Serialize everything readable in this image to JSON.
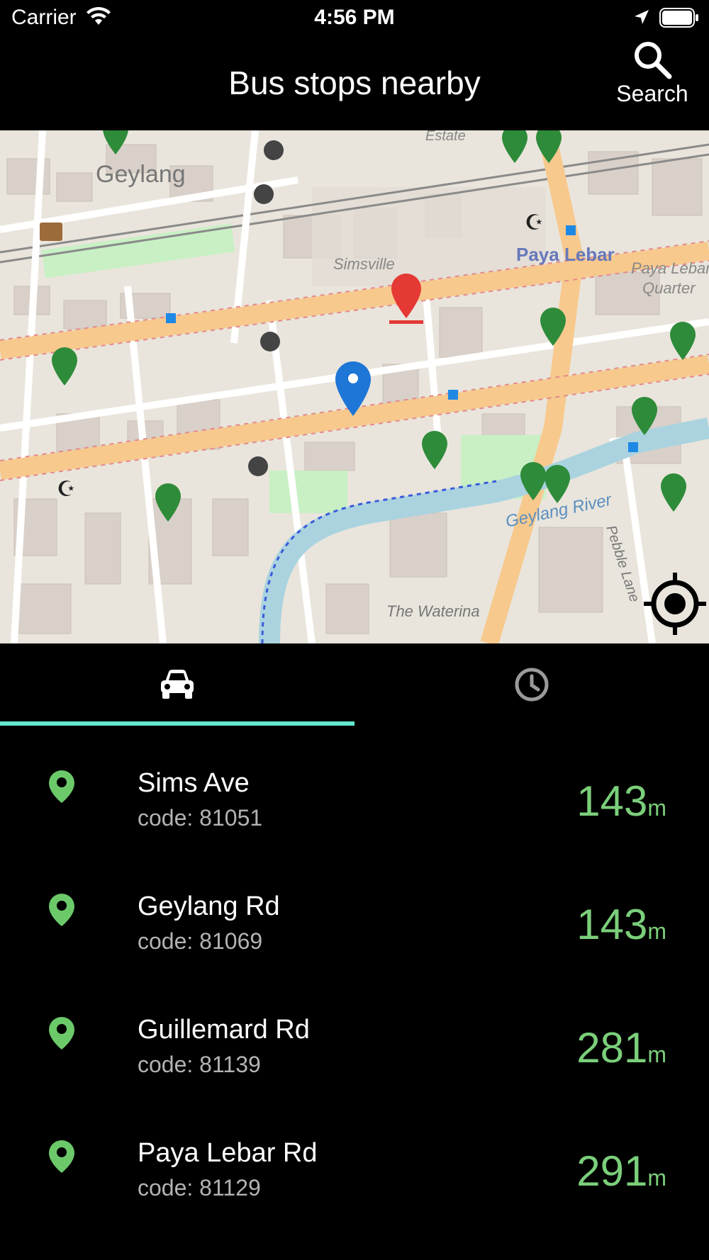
{
  "status_bar": {
    "carrier": "Carrier",
    "time": "4:56 PM"
  },
  "header": {
    "title": "Bus stops nearby",
    "search_label": "Search"
  },
  "map": {
    "labels": {
      "area_geylang": "Geylang",
      "area_simsville": "Simsville",
      "area_paya_lebar": "Paya Lebar",
      "area_paya_lebar_quarter_1": "Paya Lebar",
      "area_paya_lebar_quarter_2": "Quarter",
      "estate": "Estate",
      "river": "Geylang River",
      "lane": "Pebble Lane",
      "waterina": "The Waterina"
    },
    "colors": {
      "background": "#e9e5dc",
      "major_road": "#f7c98d",
      "river": "#aad3df",
      "park": "#c8f0c4",
      "bus_stop_pin": "#2e8b3a",
      "selected_pin": "#e53935",
      "current_location_pin": "#1e76d6"
    }
  },
  "tabs": [
    {
      "name": "nearby",
      "icon": "car-icon",
      "selected": true
    },
    {
      "name": "history",
      "icon": "clock-icon",
      "selected": false
    }
  ],
  "colors": {
    "accent": "#62e6cf",
    "distance": "#7bcf7b",
    "pin": "#6cc96a"
  },
  "stops": [
    {
      "name": "Sims Ave",
      "code": "code: 81051",
      "distance": "143",
      "unit": "m"
    },
    {
      "name": "Geylang Rd",
      "code": "code: 81069",
      "distance": "143",
      "unit": "m"
    },
    {
      "name": "Guillemard Rd",
      "code": "code: 81139",
      "distance": "281",
      "unit": "m"
    },
    {
      "name": "Paya Lebar Rd",
      "code": "code: 81129",
      "distance": "291",
      "unit": "m"
    }
  ]
}
